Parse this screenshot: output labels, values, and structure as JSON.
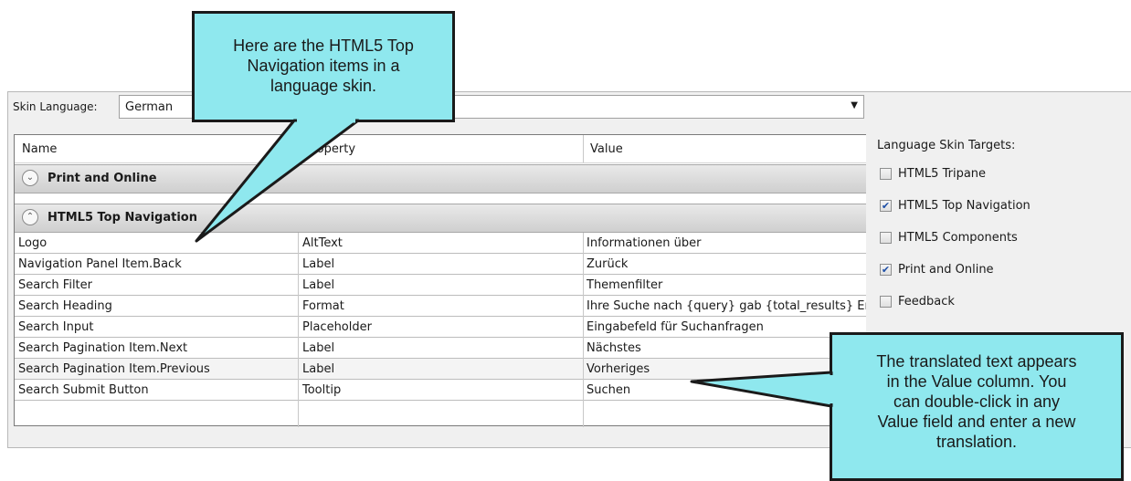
{
  "skin_language": {
    "label": "Skin Language:",
    "value": "German"
  },
  "grid": {
    "columns": [
      "Name",
      "Property",
      "Value"
    ],
    "groups": [
      {
        "label": "Print and Online",
        "expanded": false
      },
      {
        "label": "HTML5 Top Navigation",
        "expanded": true
      }
    ],
    "rows": [
      {
        "name": "Logo",
        "property": "AltText",
        "value": "Informationen über"
      },
      {
        "name": "Navigation Panel Item.Back",
        "property": "Label",
        "value": "Zurück"
      },
      {
        "name": "Search Filter",
        "property": "Label",
        "value": "Themenfilter"
      },
      {
        "name": "Search Heading",
        "property": "Format",
        "value": "Ihre Suche nach {query} gab {total_results} Ergebnisse"
      },
      {
        "name": "Search Input",
        "property": "Placeholder",
        "value": "Eingabefeld für Suchanfragen"
      },
      {
        "name": "Search Pagination Item.Next",
        "property": "Label",
        "value": "Nächstes"
      },
      {
        "name": "Search Pagination Item.Previous",
        "property": "Label",
        "value": "Vorheriges"
      },
      {
        "name": "Search Submit Button",
        "property": "Tooltip",
        "value": "Suchen"
      }
    ]
  },
  "targets": {
    "title": "Language Skin Targets:",
    "items": [
      {
        "label": "HTML5 Tripane",
        "checked": false,
        "mark": ""
      },
      {
        "label": "HTML5 Top Navigation",
        "checked": true,
        "mark": "✔"
      },
      {
        "label": "HTML5 Components",
        "checked": false,
        "mark": ""
      },
      {
        "label": "Print and Online",
        "checked": true,
        "mark": "✔"
      },
      {
        "label": "Feedback",
        "checked": false,
        "mark": ""
      }
    ]
  },
  "callouts": {
    "top": [
      "Here are the HTML5 Top",
      "Navigation items in a",
      "language skin."
    ],
    "right": [
      "The translated text appears",
      "in the Value column. You",
      "can double-click in any",
      "Value field and enter a new",
      "translation."
    ]
  },
  "colors": {
    "callout_fill": "#8fe8ee",
    "group_header": "#d8d8d8",
    "check": "#1d4ea6"
  }
}
